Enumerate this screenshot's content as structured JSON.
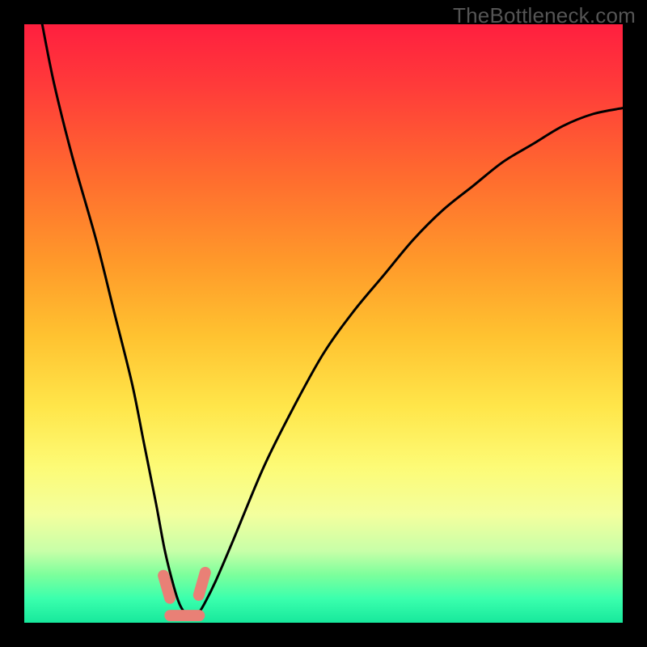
{
  "watermark": "TheBottleneck.com",
  "chart_data": {
    "type": "line",
    "title": "",
    "xlabel": "",
    "ylabel": "",
    "xlim": [
      0,
      100
    ],
    "ylim": [
      0,
      100
    ],
    "series": [
      {
        "name": "bottleneck-curve",
        "x": [
          3,
          5,
          8,
          12,
          15,
          18,
          20,
          22,
          23.5,
          25,
          26,
          27,
          28,
          29,
          30,
          32,
          35,
          40,
          45,
          50,
          55,
          60,
          65,
          70,
          75,
          80,
          85,
          90,
          95,
          100
        ],
        "y": [
          100,
          90,
          78,
          64,
          52,
          40,
          30,
          20,
          12,
          6,
          3,
          1.5,
          1,
          1.5,
          3,
          7,
          14,
          26,
          36,
          45,
          52,
          58,
          64,
          69,
          73,
          77,
          80,
          83,
          85,
          86
        ]
      }
    ],
    "markers": [
      {
        "name": "marker-left",
        "x": 23.8,
        "y": 6,
        "color": "#e98076"
      },
      {
        "name": "marker-right",
        "x": 29.7,
        "y": 6.5,
        "color": "#e98076"
      },
      {
        "name": "marker-floor",
        "x": 26.8,
        "y": 1.2,
        "color": "#e98076"
      }
    ],
    "colors": {
      "curve": "#000000",
      "marker": "#e98076",
      "gradient_top": "#ff1f3f",
      "gradient_bottom": "#17e89c",
      "frame": "#000000"
    }
  }
}
